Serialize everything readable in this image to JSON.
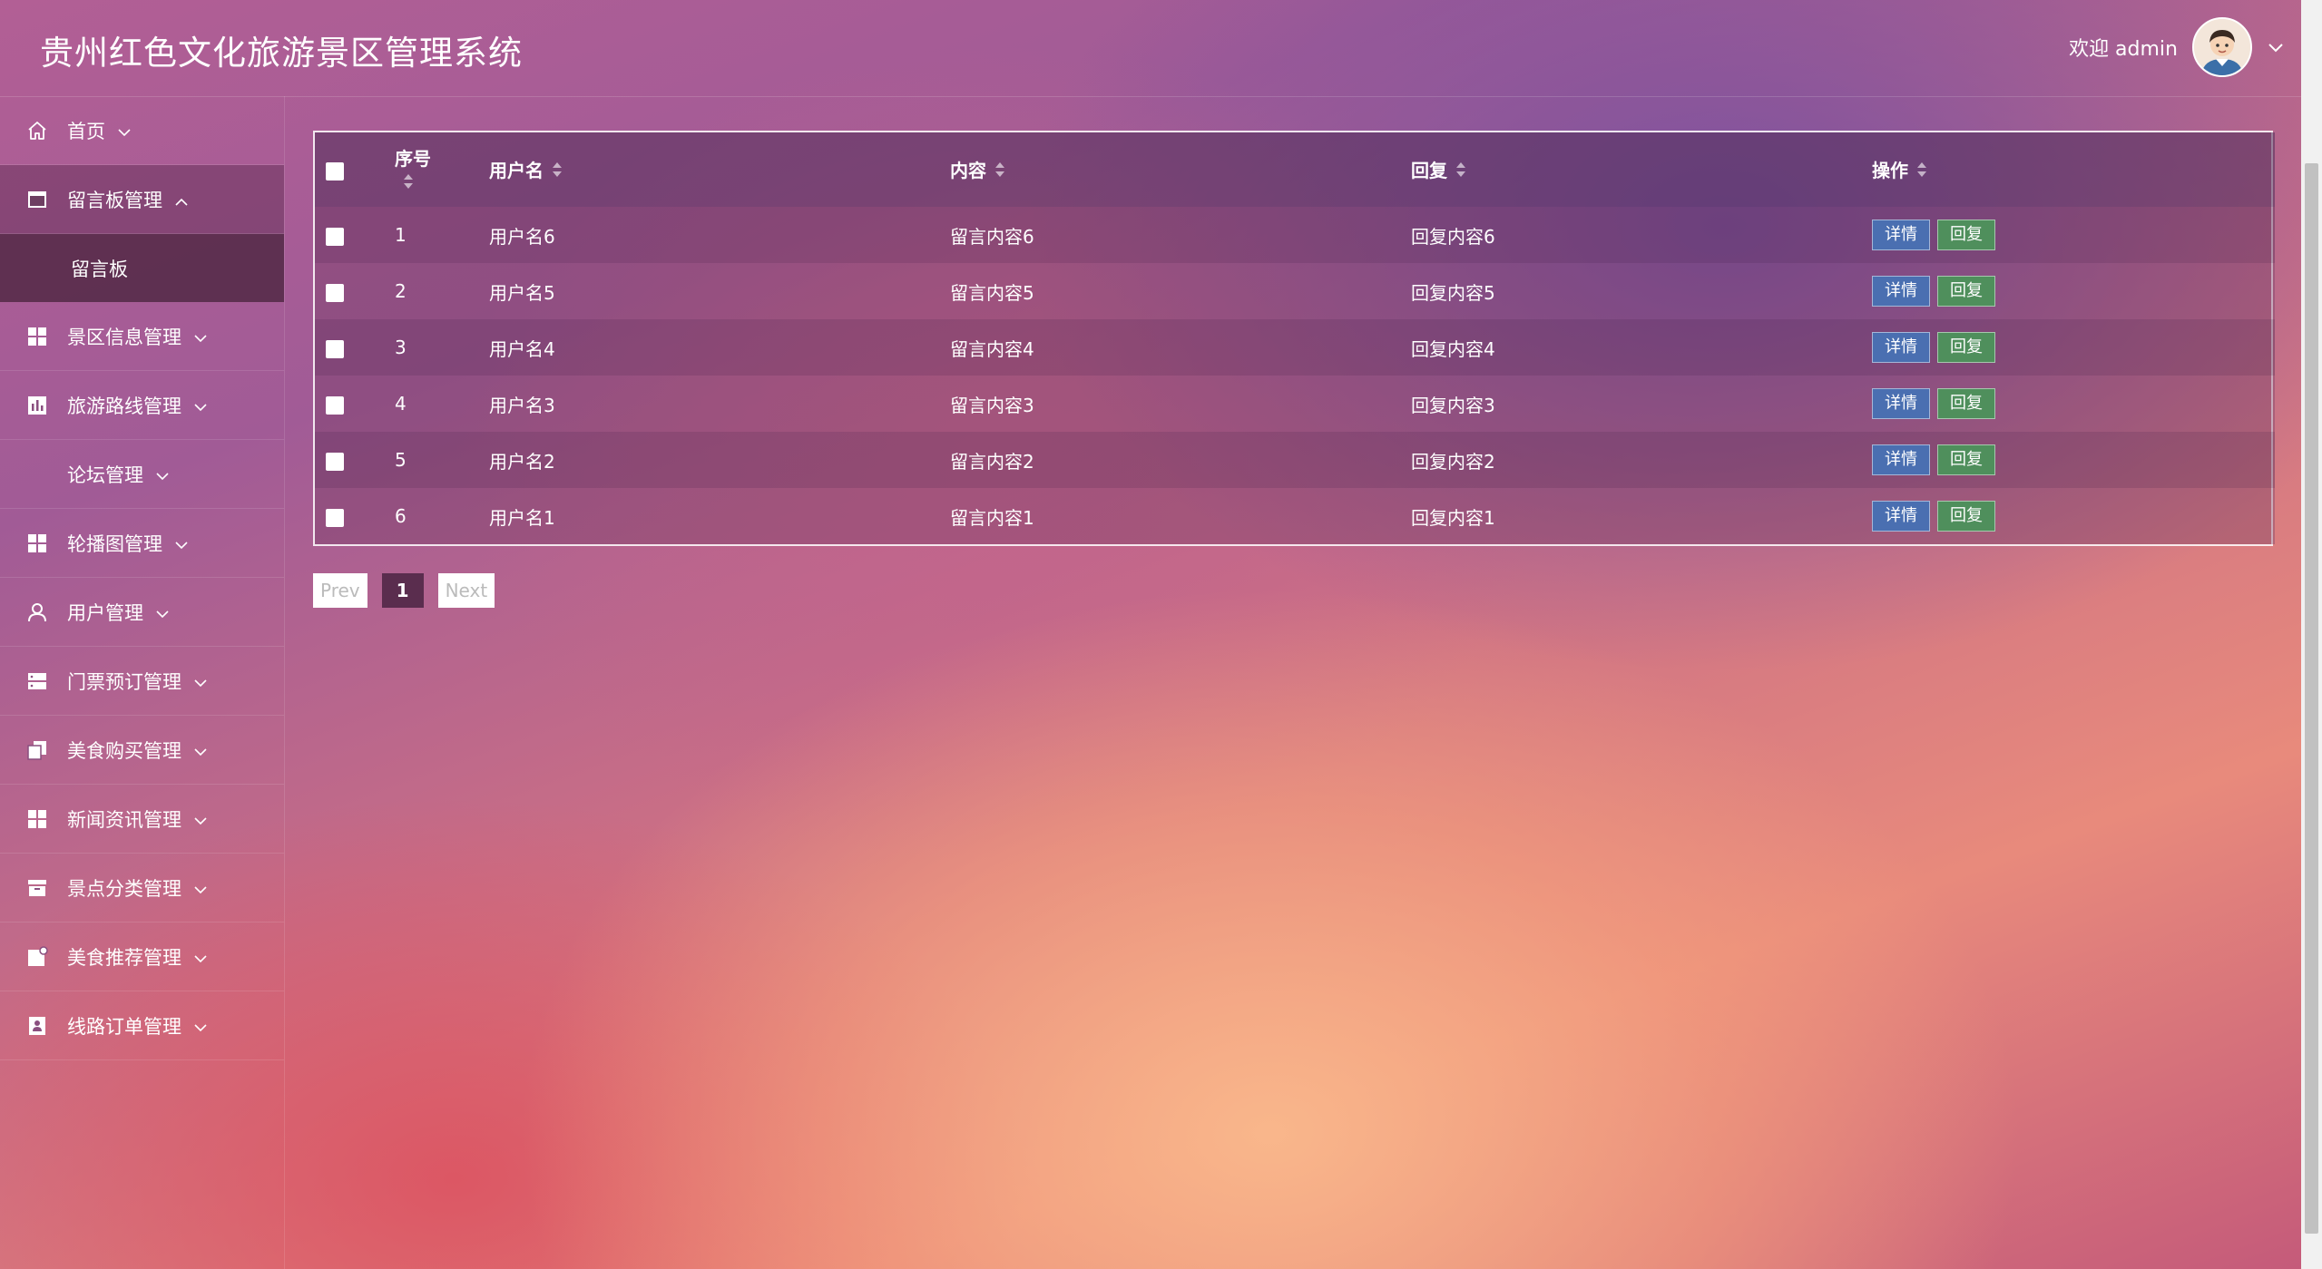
{
  "app": {
    "title": "贵州红色文化旅游景区管理系统"
  },
  "user": {
    "welcome": "欢迎 admin"
  },
  "sidebar": {
    "items": [
      {
        "label": "首页",
        "icon": "home-icon",
        "expanded": false
      },
      {
        "label": "留言板管理",
        "icon": "board-icon",
        "expanded": true,
        "sub": [
          "留言板"
        ]
      },
      {
        "label": "景区信息管理",
        "icon": "grid-icon",
        "expanded": false
      },
      {
        "label": "旅游路线管理",
        "icon": "chart-icon",
        "expanded": false
      },
      {
        "label": "论坛管理",
        "icon": "",
        "expanded": false
      },
      {
        "label": "轮播图管理",
        "icon": "grid-icon",
        "expanded": false
      },
      {
        "label": "用户管理",
        "icon": "user-icon",
        "expanded": false
      },
      {
        "label": "门票预订管理",
        "icon": "server-icon",
        "expanded": false
      },
      {
        "label": "美食购买管理",
        "icon": "copy-icon",
        "expanded": false
      },
      {
        "label": "新闻资讯管理",
        "icon": "grid-icon",
        "expanded": false
      },
      {
        "label": "景点分类管理",
        "icon": "archive-icon",
        "expanded": false
      },
      {
        "label": "美食推荐管理",
        "icon": "note-icon",
        "expanded": false
      },
      {
        "label": "线路订单管理",
        "icon": "contact-icon",
        "expanded": false
      }
    ]
  },
  "table": {
    "headers": {
      "index": "序号",
      "username": "用户名",
      "content": "内容",
      "reply": "回复",
      "action": "操作"
    },
    "detail_label": "详情",
    "reply_label": "回复",
    "rows": [
      {
        "index": "1",
        "username": "用户名6",
        "content": "留言内容6",
        "reply": "回复内容6"
      },
      {
        "index": "2",
        "username": "用户名5",
        "content": "留言内容5",
        "reply": "回复内容5"
      },
      {
        "index": "3",
        "username": "用户名4",
        "content": "留言内容4",
        "reply": "回复内容4"
      },
      {
        "index": "4",
        "username": "用户名3",
        "content": "留言内容3",
        "reply": "回复内容3"
      },
      {
        "index": "5",
        "username": "用户名2",
        "content": "留言内容2",
        "reply": "回复内容2"
      },
      {
        "index": "6",
        "username": "用户名1",
        "content": "留言内容1",
        "reply": "回复内容1"
      }
    ]
  },
  "pagination": {
    "prev": "Prev",
    "current": "1",
    "next": "Next"
  },
  "colors": {
    "detail_button": "#4a6fb1",
    "reply_button": "#4f8f5c",
    "active_nav": "#5a2d4e"
  }
}
